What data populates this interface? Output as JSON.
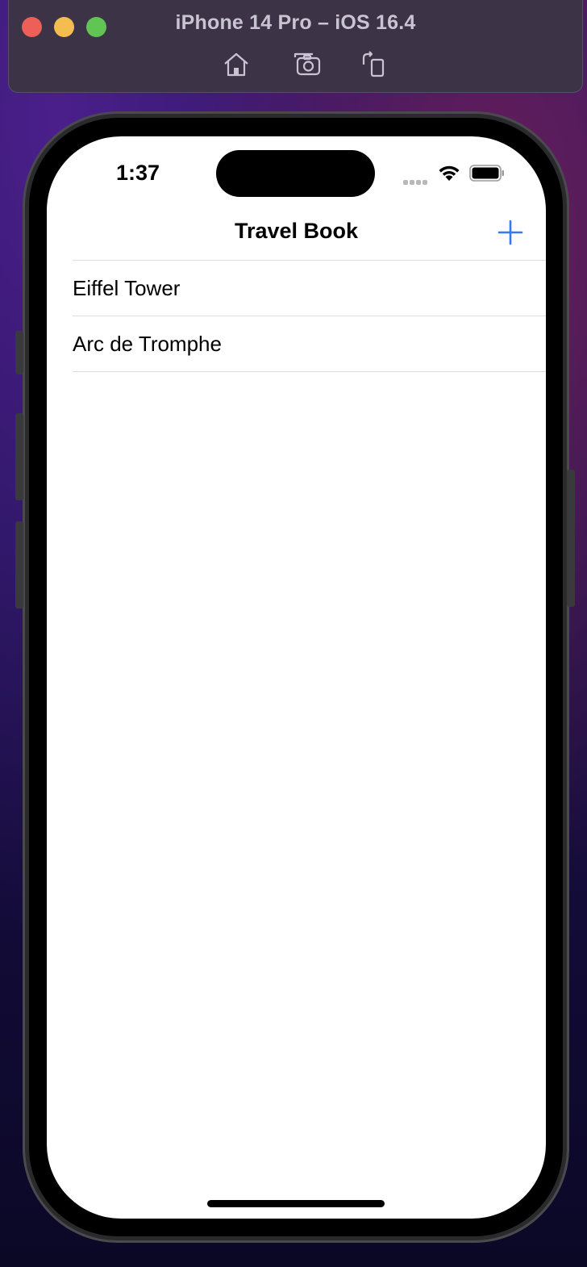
{
  "simulator": {
    "title": "iPhone 14 Pro – iOS 16.4",
    "toolbar": {
      "home_icon": "home-icon",
      "screenshot_icon": "screenshot-icon",
      "rotate_icon": "rotate-icon"
    },
    "traffic_lights": {
      "close": "#ee5f57",
      "minimize": "#f5bd4f",
      "maximize": "#61c554"
    }
  },
  "status_bar": {
    "time": "1:37",
    "icons": [
      "cellular-signal-icon",
      "wifi-icon",
      "battery-icon"
    ]
  },
  "navigation": {
    "title": "Travel Book",
    "add_icon": "plus-icon",
    "accent_color": "#3478f6"
  },
  "list": {
    "items": [
      {
        "label": "Eiffel Tower"
      },
      {
        "label": "Arc de Tromphe"
      }
    ]
  }
}
